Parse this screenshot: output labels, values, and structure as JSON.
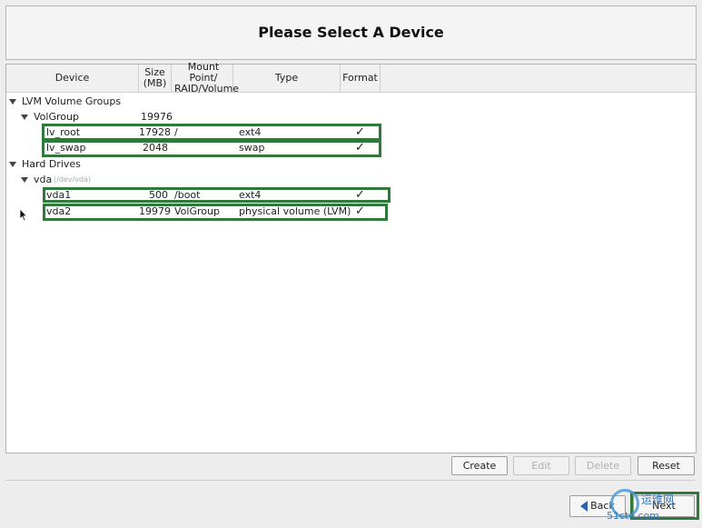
{
  "title": "Please Select A Device",
  "columns": {
    "device": "Device",
    "size_l1": "Size",
    "size_l2": "(MB)",
    "mount_l1": "Mount Point/",
    "mount_l2": "RAID/Volume",
    "type": "Type",
    "format": "Format"
  },
  "tree": {
    "lvm_group_header": "LVM Volume Groups",
    "volgroup": {
      "name": "VolGroup",
      "size": "19976"
    },
    "lv_root": {
      "name": "lv_root",
      "size": "17928",
      "mount": "/",
      "type": "ext4",
      "format": "✓"
    },
    "lv_swap": {
      "name": "lv_swap",
      "size": "2048",
      "mount": "",
      "type": "swap",
      "format": "✓"
    },
    "hard_drives_header": "Hard Drives",
    "vda": {
      "name": "vda",
      "path": "(/dev/vda)"
    },
    "vda1": {
      "name": "vda1",
      "size": "500",
      "mount": "/boot",
      "type": "ext4",
      "format": "✓"
    },
    "vda2": {
      "name": "vda2",
      "size": "19979",
      "mount": "VolGroup",
      "type": "physical volume (LVM)",
      "format": "✓"
    }
  },
  "actions": {
    "create": "Create",
    "edit": "Edit",
    "delete": "Delete",
    "reset": "Reset"
  },
  "nav": {
    "back": "Back",
    "next": "Next"
  },
  "watermark": {
    "brand": "运维网",
    "site": "51cto.com"
  },
  "colors": {
    "highlight": "#2f7a3a",
    "panel_bg": "#ffffff",
    "window_bg": "#ededed"
  }
}
